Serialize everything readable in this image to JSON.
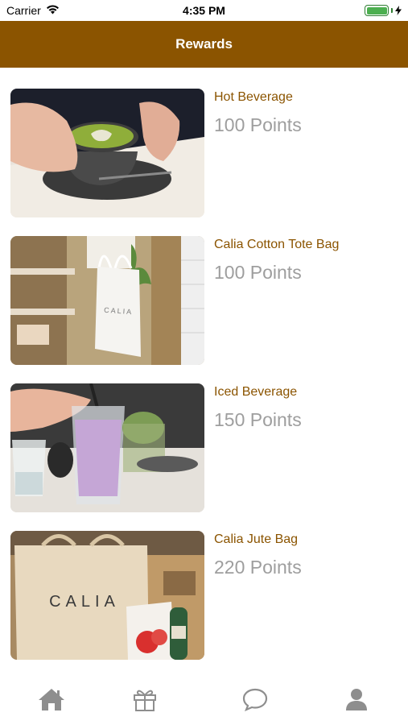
{
  "status_bar": {
    "carrier": "Carrier",
    "time": "4:35 PM",
    "battery_level": 1.0
  },
  "navbar": {
    "title": "Rewards"
  },
  "rewards": [
    {
      "name": "Hot Beverage",
      "points": "100 Points",
      "image": "matcha-latte-photo"
    },
    {
      "name": "Calia Cotton Tote Bag",
      "points": "100 Points",
      "image": "tote-bag-photo"
    },
    {
      "name": "Iced Beverage",
      "points": "150 Points",
      "image": "iced-drink-photo"
    },
    {
      "name": "Calia Jute Bag",
      "points": "220 Points",
      "image": "jute-bag-photo"
    }
  ],
  "jute_bag_print": "CALIA",
  "tote_bag_print": "CALIA",
  "tabbar": {
    "tabs": [
      "home-icon",
      "gift-icon",
      "chat-icon",
      "user-icon"
    ],
    "icon_color": "#8e8e8e"
  },
  "colors": {
    "brand": "#8b5400",
    "points_text": "#9e9e9e"
  }
}
